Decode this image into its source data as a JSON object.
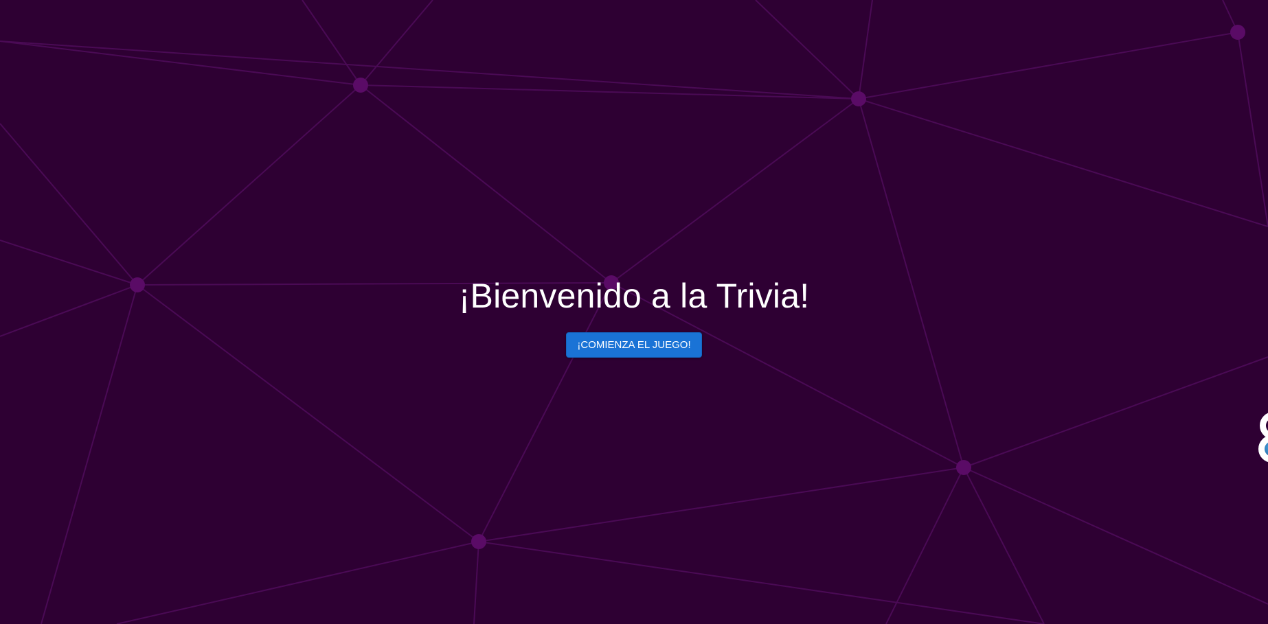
{
  "page": {
    "title": "¡Bienvenido a la Trivia!",
    "start_button_label": "¡COMIENZA EL JUEGO!"
  },
  "background": {
    "style": "network-mesh",
    "base_color": "#2e0033",
    "line_color": "#4a0a55",
    "node_color": "#5a0b66"
  },
  "colors": {
    "accent": "#1a73d6",
    "text": "#ffffff"
  },
  "side_widget": {
    "icon": "globe-icon"
  }
}
